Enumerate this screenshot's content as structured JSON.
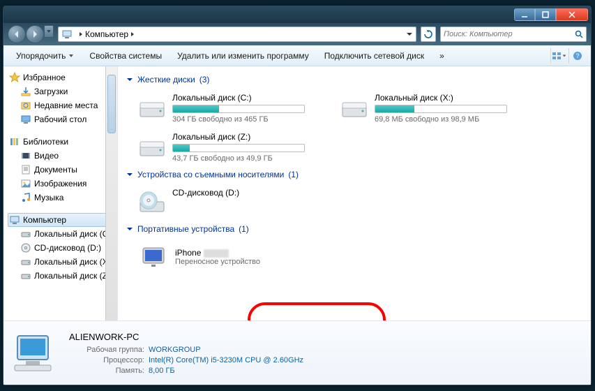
{
  "address": {
    "root_icon": "computer",
    "path": "Компьютер",
    "search_placeholder": "Поиск: Компьютер"
  },
  "toolbar": {
    "organize": "Упорядочить",
    "system_props": "Свойства системы",
    "uninstall": "Удалить или изменить программу",
    "map_drive": "Подключить сетевой диск",
    "more": "»"
  },
  "tree": {
    "favorites": {
      "label": "Избранное",
      "items": [
        {
          "id": "downloads",
          "label": "Загрузки",
          "icon": "download"
        },
        {
          "id": "recent",
          "label": "Недавние места",
          "icon": "recent"
        },
        {
          "id": "desktop",
          "label": "Рабочий стол",
          "icon": "desktop"
        }
      ]
    },
    "libraries": {
      "label": "Библиотеки",
      "items": [
        {
          "id": "videos",
          "label": "Видео",
          "icon": "video"
        },
        {
          "id": "documents",
          "label": "Документы",
          "icon": "doc"
        },
        {
          "id": "pictures",
          "label": "Изображения",
          "icon": "image"
        },
        {
          "id": "music",
          "label": "Музыка",
          "icon": "music"
        }
      ]
    },
    "computer": {
      "label": "Компьютер",
      "items": [
        {
          "id": "c",
          "label": "Локальный диск (C:)"
        },
        {
          "id": "d",
          "label": "CD-дисковод (D:)"
        },
        {
          "id": "x",
          "label": "Локальный диск (X:)"
        },
        {
          "id": "z",
          "label": "Локальный диск (Z:)"
        }
      ]
    }
  },
  "groups": {
    "hdd": {
      "title": "Жесткие диски",
      "count": "(3)",
      "drives": [
        {
          "name": "Локальный диск (C:)",
          "free_text": "304 ГБ свободно из 465 ГБ",
          "fill_pct": 35
        },
        {
          "name": "Локальный диск (X:)",
          "free_text": "69,8 МБ свободно из 98,9 МБ",
          "fill_pct": 30
        },
        {
          "name": "Локальный диск (Z:)",
          "free_text": "43,7 ГБ свободно из 49,9 ГБ",
          "fill_pct": 13
        }
      ]
    },
    "removable": {
      "title": "Устройства со съемными носителями",
      "count": "(1)",
      "drives": [
        {
          "name": "CD-дисковод (D:)"
        }
      ]
    },
    "portable": {
      "title": "Портативные устройства",
      "count": "(1)",
      "items": [
        {
          "name": "iPhone",
          "desc": "Переносное устройство"
        }
      ]
    }
  },
  "details": {
    "title": "ALIENWORK-PC",
    "rows": [
      {
        "label": "Рабочая группа:",
        "value": "WORKGROUP"
      },
      {
        "label": "Процессор:",
        "value": "Intel(R) Core(TM) i5-3230M CPU @ 2.60GHz"
      },
      {
        "label": "Память:",
        "value": "8,00 ГБ"
      }
    ]
  }
}
